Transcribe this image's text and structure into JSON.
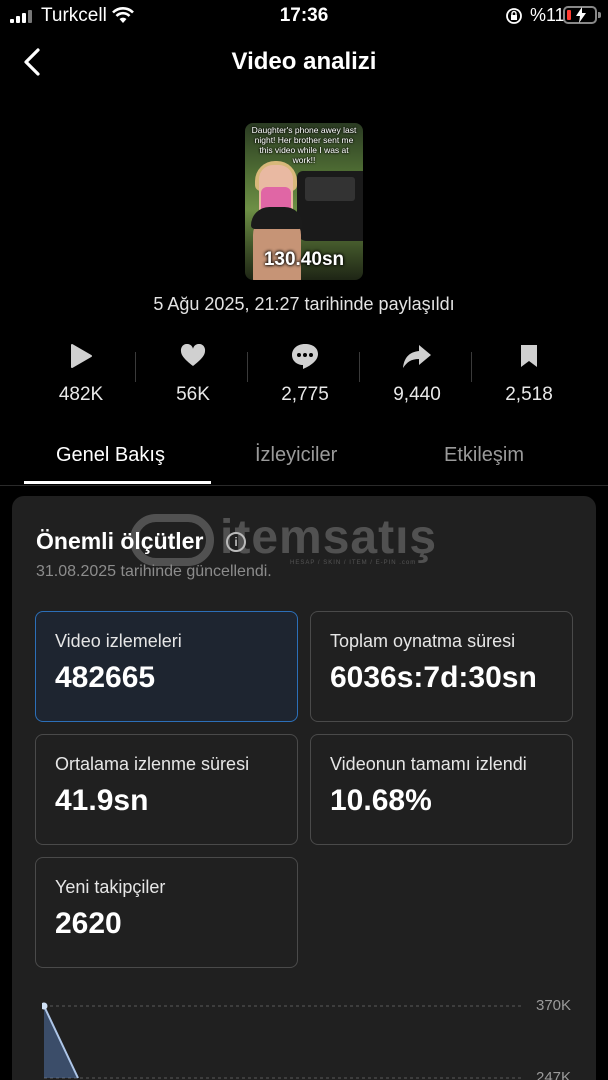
{
  "status_bar": {
    "carrier": "Turkcell",
    "time": "17:36",
    "battery": "%11"
  },
  "header": {
    "title": "Video analizi"
  },
  "video": {
    "caption": "Daughter's phone awey last night! Her brother sent me this video while I was at work!!",
    "duration": "130.40sn",
    "shared_date": "5 Ağu 2025, 21:27 tarihinde paylaşıldı"
  },
  "stats": [
    {
      "icon": "play-icon",
      "value": "482K"
    },
    {
      "icon": "heart-icon",
      "value": "56K"
    },
    {
      "icon": "comment-icon",
      "value": "2,775"
    },
    {
      "icon": "share-icon",
      "value": "9,440"
    },
    {
      "icon": "bookmark-icon",
      "value": "2,518"
    }
  ],
  "tabs": [
    {
      "label": "Genel Bakış",
      "active": true
    },
    {
      "label": "İzleyiciler",
      "active": false
    },
    {
      "label": "Etkileşim",
      "active": false
    }
  ],
  "metrics_card": {
    "title": "Önemli ölçütler",
    "updated": "31.08.2025 tarihinde güncellendi.",
    "watermark": "itemsatış",
    "watermark_sub": "HESAP / SKIN / ITEM / E-PIN .com",
    "metrics": [
      {
        "label": "Video izlemeleri",
        "value": "482665",
        "selected": true
      },
      {
        "label": "Toplam oynatma süresi",
        "value": "6036s:7d:30sn",
        "selected": false
      },
      {
        "label": "Ortalama izlenme süresi",
        "value": "41.9sn",
        "selected": false
      },
      {
        "label": "Videonun tamamı izlendi",
        "value": "10.68%",
        "selected": false
      },
      {
        "label": "Yeni takipçiler",
        "value": "2620",
        "selected": false
      }
    ]
  },
  "chart_data": {
    "type": "line",
    "y_tick_labels": [
      "370K",
      "247K"
    ],
    "y_ticks": [
      370000,
      247000
    ],
    "ylim": [
      247000,
      370000
    ],
    "x": [
      0,
      1
    ],
    "values": [
      370000,
      247000
    ],
    "grid": true,
    "colors": {
      "line": "#aec6e8",
      "point": "#cfe0f5",
      "fill": "#5d86c4"
    }
  },
  "colors": {
    "background": "#000000",
    "card": "#202020",
    "selected_border": "#2c6fb8",
    "battery_low": "#ff3b30"
  }
}
